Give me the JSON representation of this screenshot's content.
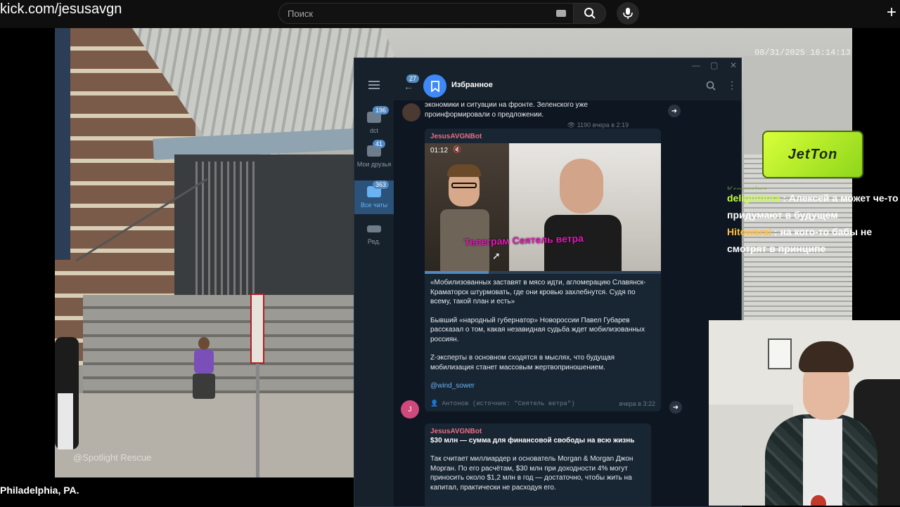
{
  "browser": {
    "url": "kick.com/jesusavgn",
    "search_placeholder": "Поиск"
  },
  "video": {
    "watermark": "@Spotlight Rescue",
    "timestamp": "08/31/2025 16:14:13",
    "caption": "Philadelphia, PA."
  },
  "telegram": {
    "window_controls": {
      "minimize": "—",
      "maximize": "▢",
      "close": "✕"
    },
    "sidebar": {
      "folders": [
        {
          "label": "dct",
          "badge": "196"
        },
        {
          "label": "Мои друзья",
          "badge": "41"
        },
        {
          "label": "Все чаты",
          "badge": "363"
        },
        {
          "label": "Ред.",
          "badge": ""
        }
      ]
    },
    "header": {
      "back_badge": "27",
      "title": "Избранное"
    },
    "messages": {
      "top": {
        "text": "экономики и ситуации на фронте. Зеленского уже проинформировали о предложении.",
        "views": "1190",
        "time": "вчера в 2:19"
      },
      "video_post": {
        "sender": "JesusAVGNBot",
        "video_time": "01:12",
        "video_caption": "Телеграм Сеятель ветра",
        "video_progress": 0.27,
        "paragraphs": [
          "«Мобилизованных заставят в мясо идти, агломерацию Славянск-Краматорск штурмовать, где они кровью захлебнутся. Судя по всему, такой план и есть»",
          "Бывший «народный губернатор» Новороссии Павел Губарев рассказал о том, какая незавидная судьба ждет мобилизованных россиян.",
          "Z-эксперты в основном сходятся в мыслях, что будущая мобилизация станет массовым жертвоприношением."
        ],
        "link": "@wind_sower",
        "signature": "👤 Антонов (источник: \"Сеятель ветра\")",
        "time": "вчера в 3:22",
        "avatar_letter": "J"
      },
      "next_post": {
        "sender": "JesusAVGNBot",
        "headline": "$30 млн — сумма для финансовой свободы на всю жизнь",
        "text": "Так считает миллиардер и основатель Morgan & Morgan Джон Морган. По его расчётам, $30 млн при доходности 4% могут приносить около $1,2 млн в год — достаточно, чтобы жить на капитал, практически не расходуя его."
      }
    }
  },
  "stream_overlay": {
    "sponsor_logo": "JetTon",
    "chat_faded": "Kronprinz",
    "chat": [
      {
        "user": "delightdota",
        "text": "Алексей а может че-то придумают в будущем"
      },
      {
        "user": "Hitowarai",
        "text": "на кого-то бабы не смотрят в принципе"
      }
    ]
  },
  "colors": {
    "telegram_bg": "#0e1621",
    "telegram_panel": "#17212b",
    "bubble": "#182533",
    "accent": "#5288c1",
    "bot_name": "#e96f83",
    "video_caption": "#e01ab4",
    "chat_user_1": "#c7ff45",
    "chat_user_2": "#ffbf3f"
  }
}
